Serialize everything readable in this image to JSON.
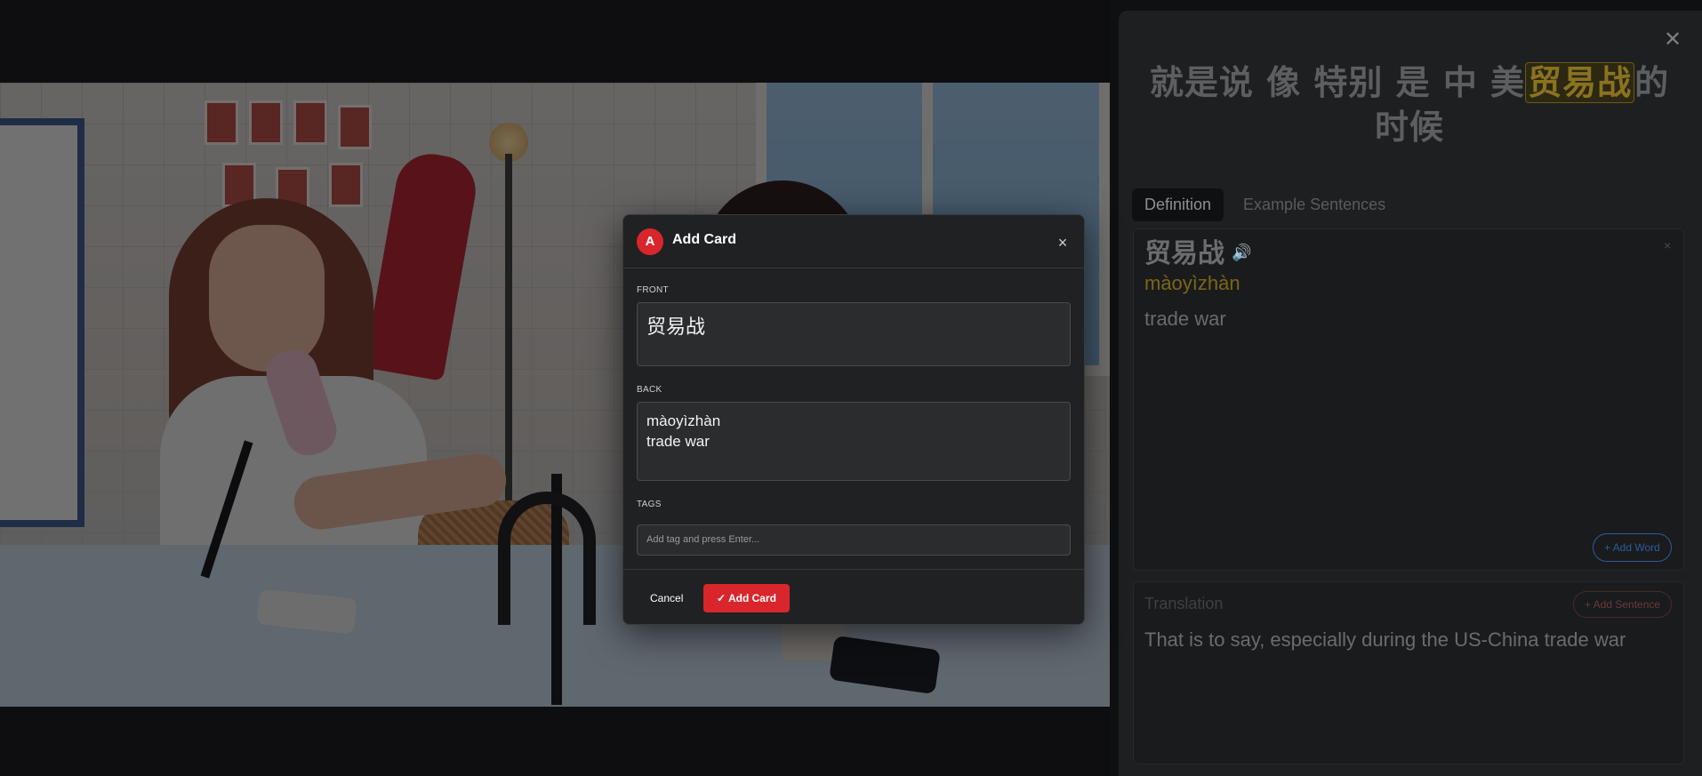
{
  "sidebar": {
    "close_glyph": "✕",
    "sentence": {
      "before": "就是说 像 特别 是 中 美",
      "highlight": "贸易战",
      "after": "的 时候"
    },
    "tabs": [
      {
        "label": "Definition",
        "active": true
      },
      {
        "label": "Example Sentences",
        "active": false
      }
    ],
    "definition": {
      "word": "贸易战",
      "speaker_icon": "🔊",
      "close_glyph": "×",
      "pinyin": "màoyìzhàn",
      "meaning": "trade war",
      "add_word_label": "+ Add Word"
    },
    "translation": {
      "label": "Translation",
      "add_sentence_label": "+ Add Sentence",
      "text": "That is to say, especially during the US-China trade war"
    }
  },
  "modal": {
    "logo_letter": "A",
    "title": "Add Card",
    "close_glyph": "×",
    "front_label": "FRONT",
    "front_value": "贸易战",
    "back_label": "BACK",
    "back_value": "màoyìzhàn\ntrade war",
    "tags_label": "TAGS",
    "tags_placeholder": "Add tag and press Enter...",
    "cancel_label": "Cancel",
    "add_card_label": "✓ Add Card"
  },
  "colors": {
    "accent_red": "#d9262d",
    "pinyin_gold": "#7c6617",
    "link_blue": "#2d5b9a"
  }
}
